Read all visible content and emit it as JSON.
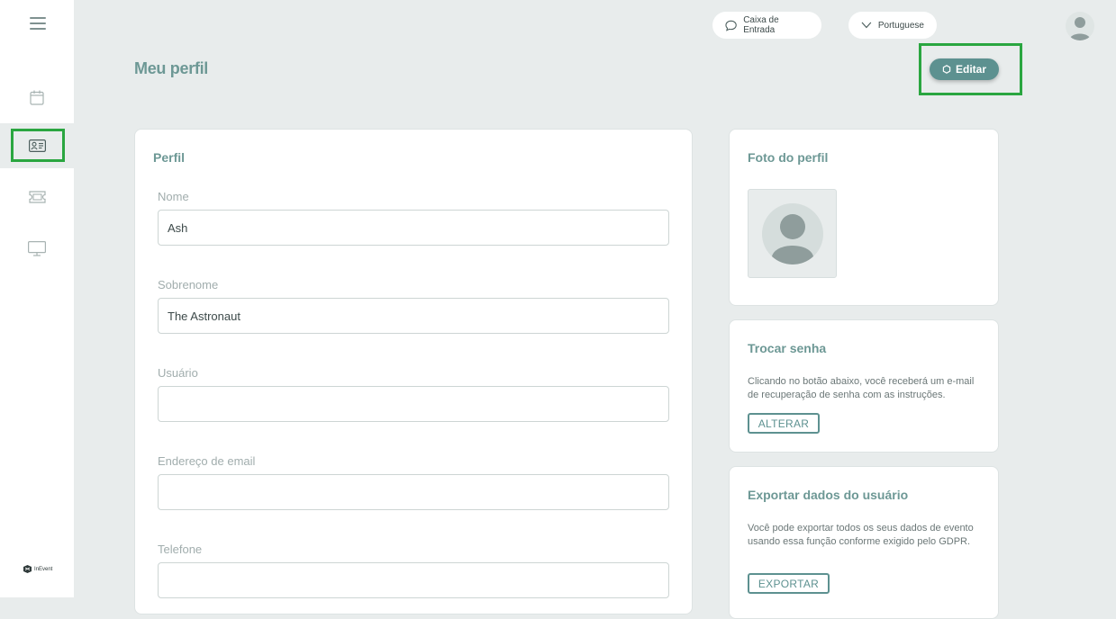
{
  "topbar": {
    "inbox_label": "Caixa de Entrada",
    "language_label": "Portuguese"
  },
  "page": {
    "title": "Meu perfil",
    "edit_label": "Editar"
  },
  "profile": {
    "title": "Perfil",
    "fields": [
      {
        "label": "Nome",
        "value": "Ash",
        "placeholder": ""
      },
      {
        "label": "Sobrenome",
        "value": "The Astronaut",
        "placeholder": ""
      },
      {
        "label": "Usuário",
        "value": "",
        "placeholder": ""
      },
      {
        "label": "Endereço de email",
        "value": "",
        "placeholder": ""
      },
      {
        "label": "Telefone",
        "value": "",
        "placeholder": ""
      }
    ]
  },
  "photo": {
    "title": "Foto do perfil"
  },
  "password": {
    "title": "Trocar senha",
    "description": "Clicando no botão abaixo, você receberá um e-mail de recuperação de senha com as instruções.",
    "button": "ALTERAR"
  },
  "export": {
    "title": "Exportar dados do usuário",
    "description": "Você pode exportar todos os seus dados de evento usando essa função conforme exigido pelo GDPR.",
    "button": "EXPORTAR"
  },
  "brand": {
    "name": "InEvent"
  },
  "colors": {
    "accent": "#5d9190",
    "title": "#6d9895",
    "highlight": "#2aa640",
    "background": "#e8ecec"
  },
  "icons": [
    "menu-icon",
    "calendar-icon",
    "id-card-icon",
    "ticket-icon",
    "monitor-icon",
    "chat-icon",
    "chevron-down-icon",
    "user-avatar-icon",
    "gear-icon"
  ]
}
